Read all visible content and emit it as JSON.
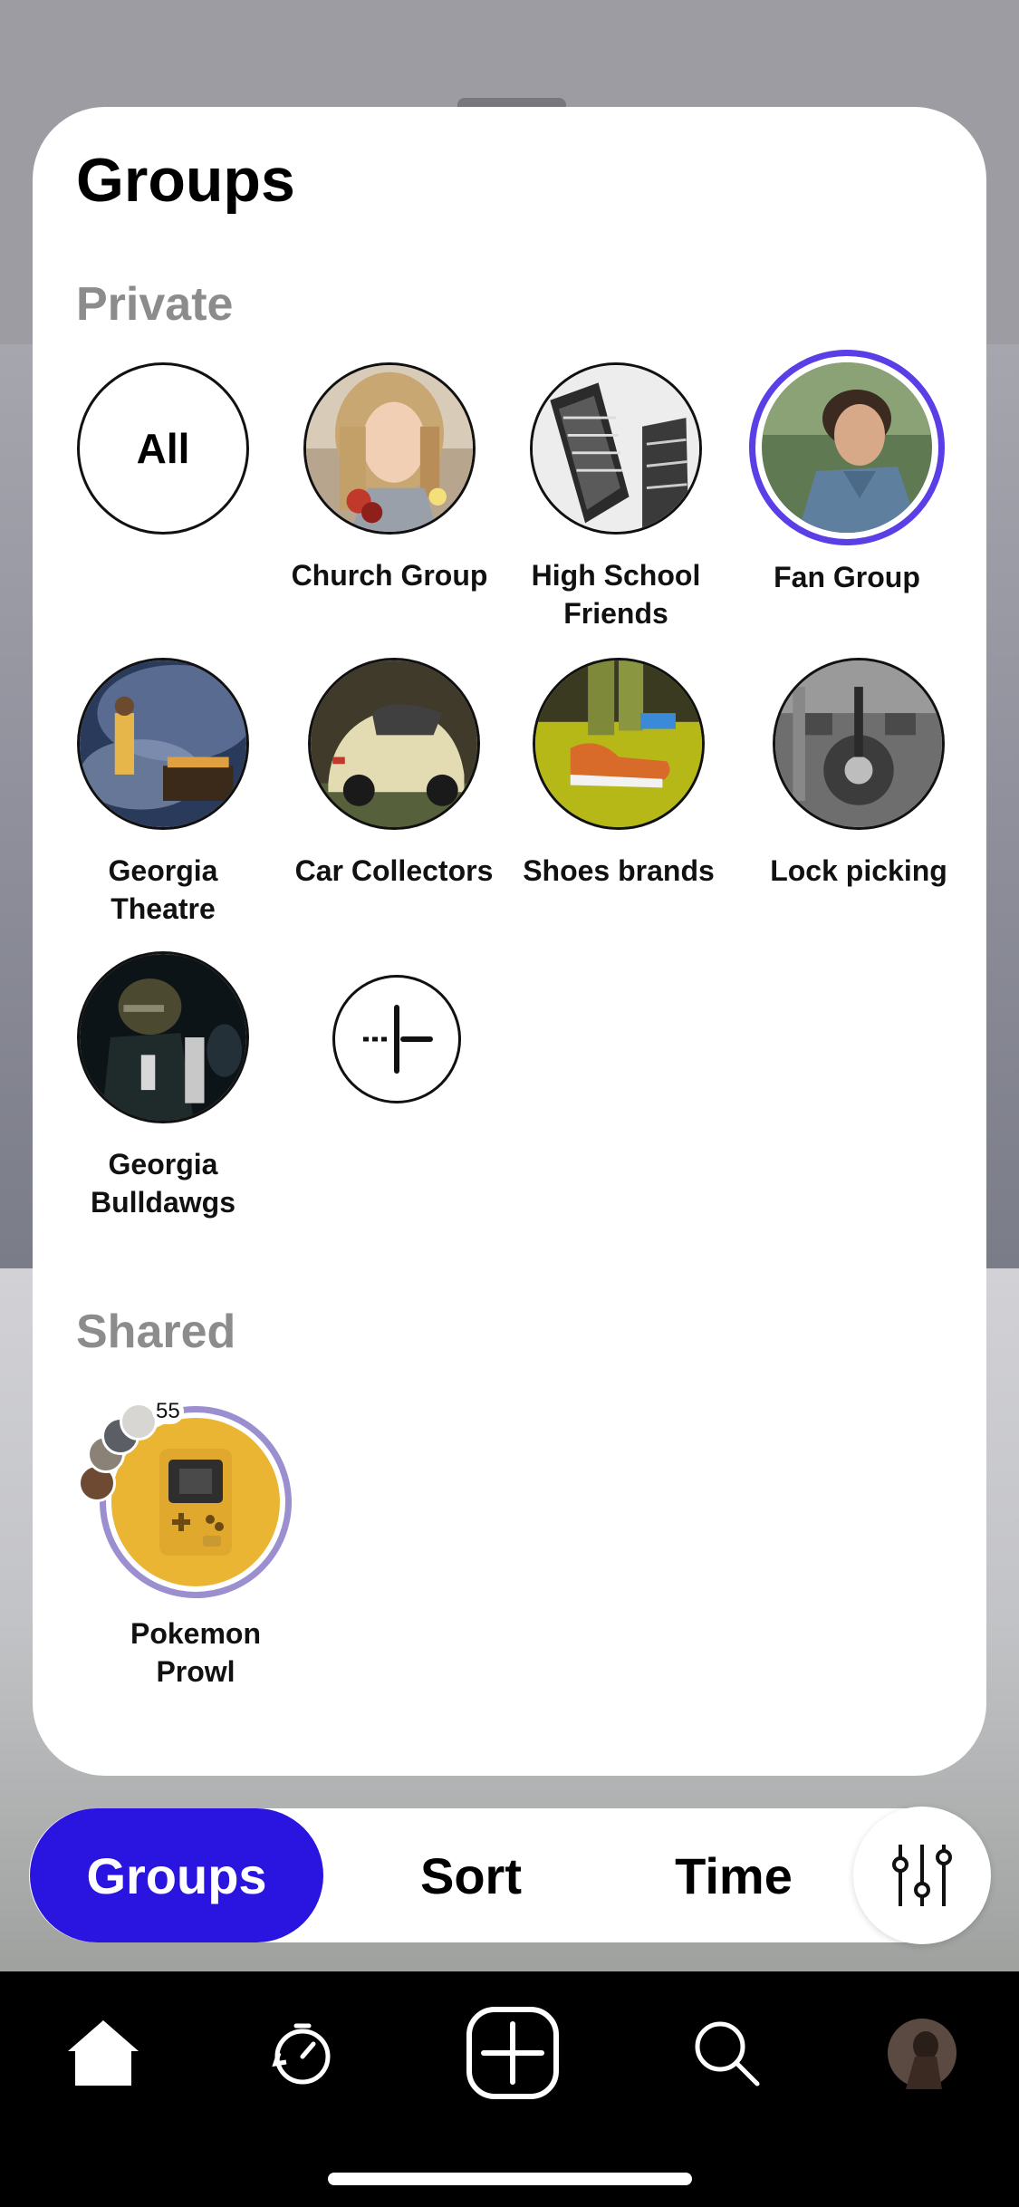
{
  "title": "Groups",
  "sections": {
    "private": "Private",
    "shared": "Shared"
  },
  "private_groups": [
    {
      "label": "All",
      "circle_text": "All"
    },
    {
      "label": "Church Group",
      "image": "woman-portrait-photo"
    },
    {
      "label": "High School\nFriends",
      "image": "buildings-photo"
    },
    {
      "label": "Fan Group",
      "image": "man-portrait-photo",
      "selected": true
    },
    {
      "label": "Georgia\nTheatre",
      "image": "concert-photo"
    },
    {
      "label": "Car Collectors",
      "image": "vintage-car-photo"
    },
    {
      "label": "Shoes brands",
      "image": "sneakers-photo"
    },
    {
      "label": "Lock picking",
      "image": "vault-door-photo"
    },
    {
      "label": "Georgia\nBulldawgs",
      "image": "football-player-photo"
    }
  ],
  "shared_groups": [
    {
      "label": "Pokemon\nProwl",
      "image": "gameboy-icon",
      "member_count": "55"
    }
  ],
  "bottom_bar": {
    "groups": "Groups",
    "sort": "Sort",
    "time": "Time"
  },
  "colors": {
    "accent": "#2A14E0",
    "selected_ring": "#5B3FE6",
    "shared_ring": "#9B8FD0",
    "section_gray": "#8C8C8C"
  },
  "nav": [
    "home-icon",
    "timer-icon",
    "create-icon",
    "search-icon",
    "profile-avatar"
  ]
}
